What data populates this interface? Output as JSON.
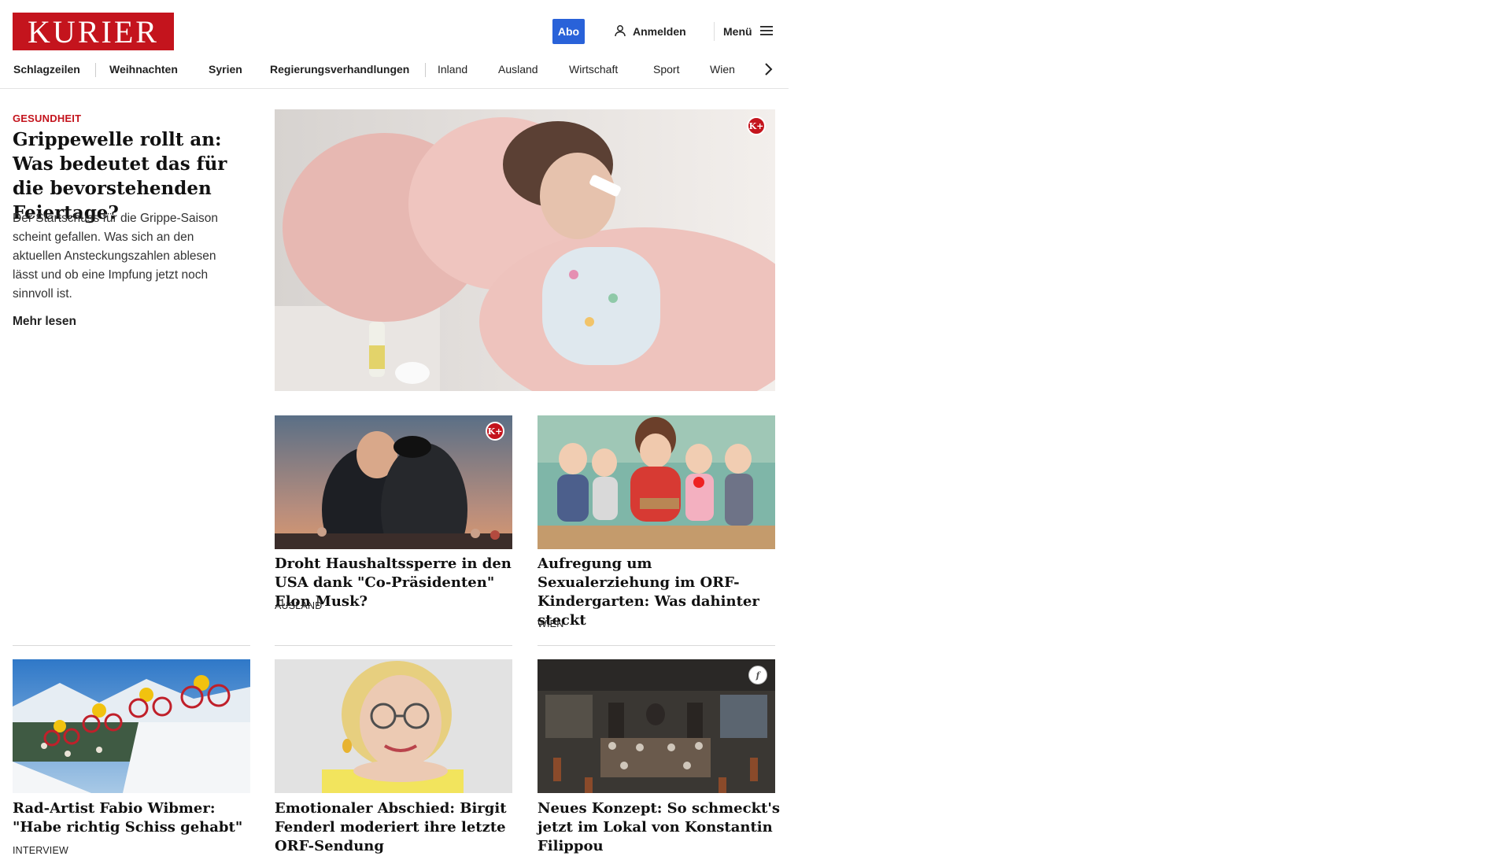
{
  "brand": {
    "logo_text": "KURIER",
    "accent": "#c4141d",
    "abo_color": "#2962d9"
  },
  "header": {
    "abo_label": "Abo",
    "login_label": "Anmelden",
    "menu_label": "Menü"
  },
  "nav": {
    "items": [
      "Schlagzeilen",
      "Weihnachten",
      "Syrien",
      "Regierungsverhandlungen",
      "Inland",
      "Ausland",
      "Wirtschaft",
      "Sport",
      "Wien"
    ]
  },
  "lead": {
    "kicker": "GESUNDHEIT",
    "title": "Grippewelle rollt an: Was bedeutet das für die be­vorstehenden Feiertage?",
    "teaser": "Der Startschuss für die Grippe-Saison scheint gefallen. Was sich an den aktuellen Ansteckungszahlen ablesen lässt und ob eine Impfung jetzt noch sinnvoll ist.",
    "more_label": "Mehr lesen",
    "badge": "K+"
  },
  "cards": [
    {
      "title": "Droht Haushaltssperre in den USA dank \"Co-Präsidenten\" Elon Musk?",
      "category": "AUSLAND",
      "badge": "K+"
    },
    {
      "title": "Aufregung um Sexualerziehung im ORF-Kindergarten: Was dahinter steckt",
      "category": "WIEN",
      "badge": ""
    },
    {
      "title": "Rad-Artist Fabio Wibmer: \"Habe richtig Schiss gehabt\"",
      "category": "INTERVIEW",
      "badge": ""
    },
    {
      "title": "Emotionaler Abschied: Birgit Fen­derl moderiert ihre letzte ORF-Sendung",
      "category": "",
      "badge": ""
    },
    {
      "title": "Neues Konzept: So schmeckt's jetzt im Lokal von Konstantin Filippou",
      "category": "",
      "badge": "f"
    }
  ]
}
